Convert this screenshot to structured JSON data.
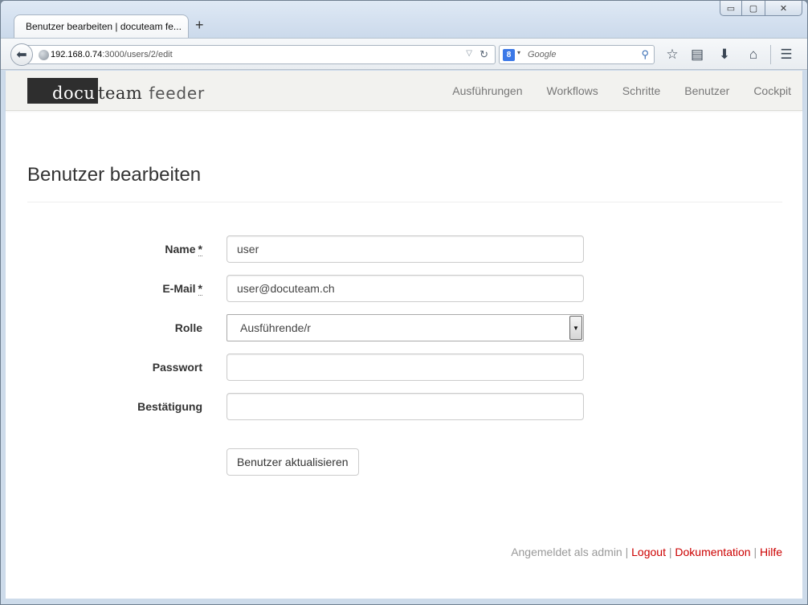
{
  "browser": {
    "tab_title": "Benutzer bearbeiten | docuteam fe...",
    "new_tab": "+",
    "url_host": "192.168.0.74",
    "url_path": ":3000/users/2/edit",
    "search_placeholder": "Google",
    "window_controls": {
      "minimize": "▭",
      "maximize": "▢",
      "close": "✕"
    },
    "icons": [
      "back-arrow-icon",
      "globe-icon",
      "reload-icon",
      "google-icon",
      "search-icon",
      "bookmark-star-icon",
      "reading-list-icon",
      "download-icon",
      "home-icon",
      "menu-icon"
    ]
  },
  "site": {
    "logo": {
      "part1": "docu",
      "part2": "team",
      "part3": "feeder"
    },
    "nav": [
      "Ausführungen",
      "Workflows",
      "Schritte",
      "Benutzer",
      "Cockpit"
    ]
  },
  "page": {
    "title": "Benutzer bearbeiten",
    "form": {
      "name": {
        "label": "Name",
        "required_mark": "*",
        "value": "user"
      },
      "email": {
        "label": "E-Mail",
        "required_mark": "*",
        "value": "user@docuteam.ch"
      },
      "role": {
        "label": "Rolle",
        "selected": "Ausführende/r"
      },
      "password": {
        "label": "Passwort",
        "value": ""
      },
      "confirmation": {
        "label": "Bestätigung",
        "value": ""
      },
      "submit_label": "Benutzer aktualisieren"
    },
    "footer": {
      "logged_in_text": "Angemeldet als admin",
      "sep": "|",
      "logout": "Logout",
      "documentation": "Dokumentation",
      "help": "Hilfe"
    }
  },
  "colors": {
    "link_red": "#cc0000",
    "header_bg": "#f2f2ef",
    "logo_dark": "#2e2e2e"
  }
}
